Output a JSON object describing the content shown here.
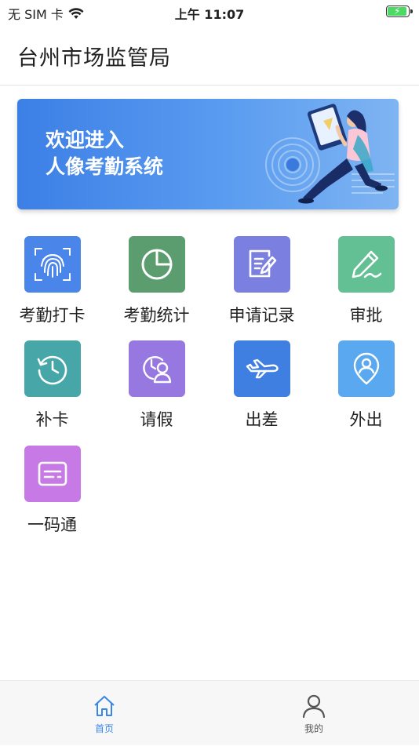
{
  "status_bar": {
    "carrier": "无 SIM 卡",
    "time": "上午 11:07"
  },
  "header": {
    "title": "台州市场监管局"
  },
  "banner": {
    "line1": "欢迎进入",
    "line2": "人像考勤系统"
  },
  "grid_items": [
    {
      "label": "考勤打卡",
      "icon": "fingerprint-icon",
      "color": "#4a86ea"
    },
    {
      "label": "考勤统计",
      "icon": "pie-chart-icon",
      "color": "#5c9d6f"
    },
    {
      "label": "申请记录",
      "icon": "edit-note-icon",
      "color": "#7b7fe0"
    },
    {
      "label": "审批",
      "icon": "pen-icon",
      "color": "#63bf94"
    },
    {
      "label": "补卡",
      "icon": "history-clock-icon",
      "color": "#47a6a8"
    },
    {
      "label": "请假",
      "icon": "person-clock-icon",
      "color": "#9777e0"
    },
    {
      "label": "出差",
      "icon": "airplane-icon",
      "color": "#3f7fe2"
    },
    {
      "label": "外出",
      "icon": "location-person-icon",
      "color": "#5aa9f0"
    },
    {
      "label": "一码通",
      "icon": "card-icon",
      "color": "#c77ae6"
    }
  ],
  "tabbar": {
    "tabs": [
      {
        "label": "首页",
        "icon": "home-icon",
        "active": true
      },
      {
        "label": "我的",
        "icon": "user-icon",
        "active": false
      }
    ],
    "active_color": "#3a86e8",
    "inactive_color": "#555555"
  }
}
